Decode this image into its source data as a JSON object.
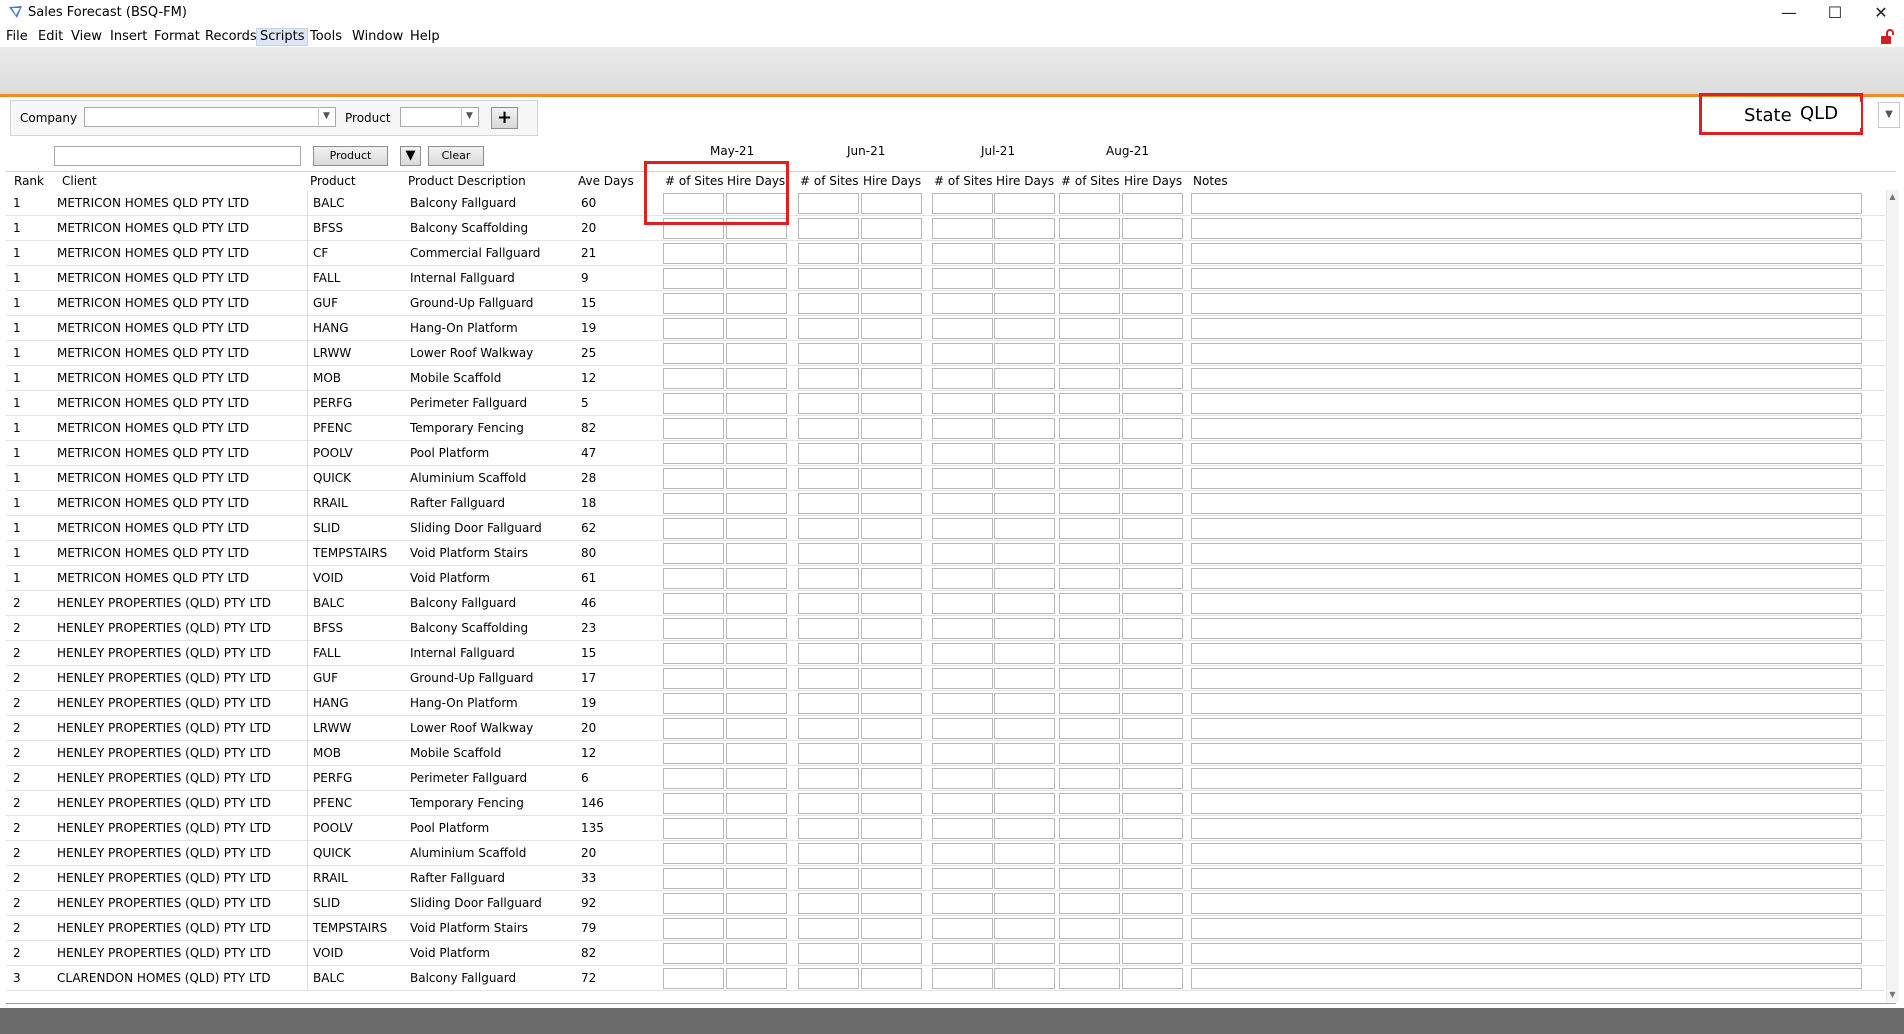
{
  "window": {
    "title": "Sales Forecast (BSQ-FM)",
    "minimize": "—",
    "maximize": "☐",
    "close": "✕"
  },
  "menu": [
    "File",
    "Edit",
    "View",
    "Insert",
    "Format",
    "Records",
    "Scripts",
    "Tools",
    "Window",
    "Help"
  ],
  "filters": {
    "company_label": "Company",
    "company_value": "",
    "product_label": "Product",
    "product_value": "",
    "plus_label": "+",
    "search_value": "",
    "product_button": "Product",
    "clear_button": "Clear",
    "state_label": "State",
    "state_value": "QLD"
  },
  "months": [
    "May-21",
    "Jun-21",
    "Jul-21",
    "Aug-21"
  ],
  "headers": {
    "rank": "Rank",
    "client": "Client",
    "product": "Product",
    "description": "Product Description",
    "ave_days": "Ave Days",
    "sites": "# of Sites",
    "hire": "Hire Days",
    "notes": "Notes"
  },
  "rows": [
    {
      "rank": "1",
      "client": "METRICON HOMES QLD PTY LTD",
      "product": "BALC",
      "description": "Balcony Fallguard",
      "ave_days": "60"
    },
    {
      "rank": "1",
      "client": "METRICON HOMES QLD PTY LTD",
      "product": "BFSS",
      "description": "Balcony Scaffolding",
      "ave_days": "20"
    },
    {
      "rank": "1",
      "client": "METRICON HOMES QLD PTY LTD",
      "product": "CF",
      "description": "Commercial Fallguard",
      "ave_days": "21"
    },
    {
      "rank": "1",
      "client": "METRICON HOMES QLD PTY LTD",
      "product": "FALL",
      "description": "Internal Fallguard",
      "ave_days": "9"
    },
    {
      "rank": "1",
      "client": "METRICON HOMES QLD PTY LTD",
      "product": "GUF",
      "description": "Ground-Up Fallguard",
      "ave_days": "15"
    },
    {
      "rank": "1",
      "client": "METRICON HOMES QLD PTY LTD",
      "product": "HANG",
      "description": "Hang-On Platform",
      "ave_days": "19"
    },
    {
      "rank": "1",
      "client": "METRICON HOMES QLD PTY LTD",
      "product": "LRWW",
      "description": "Lower Roof Walkway",
      "ave_days": "25"
    },
    {
      "rank": "1",
      "client": "METRICON HOMES QLD PTY LTD",
      "product": "MOB",
      "description": "Mobile Scaffold",
      "ave_days": "12"
    },
    {
      "rank": "1",
      "client": "METRICON HOMES QLD PTY LTD",
      "product": "PERFG",
      "description": "Perimeter Fallguard",
      "ave_days": "5"
    },
    {
      "rank": "1",
      "client": "METRICON HOMES QLD PTY LTD",
      "product": "PFENC",
      "description": "Temporary Fencing",
      "ave_days": "82"
    },
    {
      "rank": "1",
      "client": "METRICON HOMES QLD PTY LTD",
      "product": "POOLV",
      "description": "Pool Platform",
      "ave_days": "47"
    },
    {
      "rank": "1",
      "client": "METRICON HOMES QLD PTY LTD",
      "product": "QUICK",
      "description": "Aluminium Scaffold",
      "ave_days": "28"
    },
    {
      "rank": "1",
      "client": "METRICON HOMES QLD PTY LTD",
      "product": "RRAIL",
      "description": "Rafter Fallguard",
      "ave_days": "18"
    },
    {
      "rank": "1",
      "client": "METRICON HOMES QLD PTY LTD",
      "product": "SLID",
      "description": "Sliding Door Fallguard",
      "ave_days": "62"
    },
    {
      "rank": "1",
      "client": "METRICON HOMES QLD PTY LTD",
      "product": "TEMPSTAIRS",
      "description": "Void Platform Stairs",
      "ave_days": "80"
    },
    {
      "rank": "1",
      "client": "METRICON HOMES QLD PTY LTD",
      "product": "VOID",
      "description": "Void Platform",
      "ave_days": "61"
    },
    {
      "rank": "2",
      "client": "HENLEY PROPERTIES (QLD) PTY LTD",
      "product": "BALC",
      "description": "Balcony Fallguard",
      "ave_days": "46"
    },
    {
      "rank": "2",
      "client": "HENLEY PROPERTIES (QLD) PTY LTD",
      "product": "BFSS",
      "description": "Balcony Scaffolding",
      "ave_days": "23"
    },
    {
      "rank": "2",
      "client": "HENLEY PROPERTIES (QLD) PTY LTD",
      "product": "FALL",
      "description": "Internal Fallguard",
      "ave_days": "15"
    },
    {
      "rank": "2",
      "client": "HENLEY PROPERTIES (QLD) PTY LTD",
      "product": "GUF",
      "description": "Ground-Up Fallguard",
      "ave_days": "17"
    },
    {
      "rank": "2",
      "client": "HENLEY PROPERTIES (QLD) PTY LTD",
      "product": "HANG",
      "description": "Hang-On Platform",
      "ave_days": "19"
    },
    {
      "rank": "2",
      "client": "HENLEY PROPERTIES (QLD) PTY LTD",
      "product": "LRWW",
      "description": "Lower Roof Walkway",
      "ave_days": "20"
    },
    {
      "rank": "2",
      "client": "HENLEY PROPERTIES (QLD) PTY LTD",
      "product": "MOB",
      "description": "Mobile Scaffold",
      "ave_days": "12"
    },
    {
      "rank": "2",
      "client": "HENLEY PROPERTIES (QLD) PTY LTD",
      "product": "PERFG",
      "description": "Perimeter Fallguard",
      "ave_days": "6"
    },
    {
      "rank": "2",
      "client": "HENLEY PROPERTIES (QLD) PTY LTD",
      "product": "PFENC",
      "description": "Temporary Fencing",
      "ave_days": "146"
    },
    {
      "rank": "2",
      "client": "HENLEY PROPERTIES (QLD) PTY LTD",
      "product": "POOLV",
      "description": "Pool Platform",
      "ave_days": "135"
    },
    {
      "rank": "2",
      "client": "HENLEY PROPERTIES (QLD) PTY LTD",
      "product": "QUICK",
      "description": "Aluminium Scaffold",
      "ave_days": "20"
    },
    {
      "rank": "2",
      "client": "HENLEY PROPERTIES (QLD) PTY LTD",
      "product": "RRAIL",
      "description": "Rafter Fallguard",
      "ave_days": "33"
    },
    {
      "rank": "2",
      "client": "HENLEY PROPERTIES (QLD) PTY LTD",
      "product": "SLID",
      "description": "Sliding Door Fallguard",
      "ave_days": "92"
    },
    {
      "rank": "2",
      "client": "HENLEY PROPERTIES (QLD) PTY LTD",
      "product": "TEMPSTAIRS",
      "description": "Void Platform Stairs",
      "ave_days": "79"
    },
    {
      "rank": "2",
      "client": "HENLEY PROPERTIES (QLD) PTY LTD",
      "product": "VOID",
      "description": "Void Platform",
      "ave_days": "82"
    },
    {
      "rank": "3",
      "client": "CLARENDON HOMES (QLD) PTY LTD",
      "product": "BALC",
      "description": "Balcony Fallguard",
      "ave_days": "72"
    }
  ],
  "colors": {
    "accent": "#f08c28",
    "highlight": "#e02020",
    "toolbar": "#e4e4e4",
    "statusbar": "#6b6b6b"
  }
}
